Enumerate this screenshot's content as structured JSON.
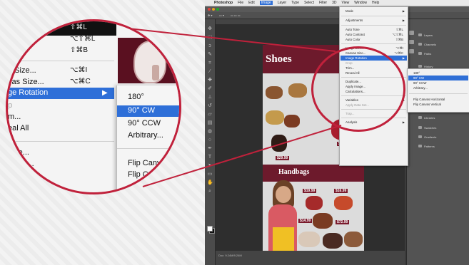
{
  "mac_menu": {
    "apple": "",
    "items": [
      "Photoshop",
      "File",
      "Edit",
      "Image",
      "Layer",
      "Type",
      "Select",
      "Filter",
      "3D",
      "View",
      "Window",
      "Help"
    ],
    "active_index": 3
  },
  "document_tab": "Untitled-1 @ 66.7%",
  "status_text": "Doc: 9.24M/9.24M",
  "image_menu": {
    "items": [
      {
        "label": "Mode",
        "shortcut": "",
        "submenu": true
      },
      {
        "label": "Adjustments",
        "shortcut": "",
        "submenu": true
      },
      {
        "label": "Auto Tone",
        "shortcut": "⇧⌘L"
      },
      {
        "label": "Auto Contrast",
        "shortcut": "⌥⇧⌘L"
      },
      {
        "label": "Auto Color",
        "shortcut": "⇧⌘B"
      },
      {
        "label": "Image Size...",
        "shortcut": "⌥⌘I"
      },
      {
        "label": "Canvas Size...",
        "shortcut": "⌥⌘C"
      },
      {
        "label": "Image Rotation",
        "shortcut": "",
        "submenu": true,
        "highlighted": true
      },
      {
        "label": "Crop",
        "shortcut": "",
        "disabled": true
      },
      {
        "label": "Trim...",
        "shortcut": ""
      },
      {
        "label": "Reveal All",
        "shortcut": ""
      },
      {
        "label": "Duplicate...",
        "shortcut": ""
      },
      {
        "label": "Apply Image...",
        "shortcut": ""
      },
      {
        "label": "Calculations...",
        "shortcut": ""
      },
      {
        "label": "Variables",
        "shortcut": "",
        "submenu": true
      },
      {
        "label": "Apply Data Set...",
        "shortcut": "",
        "disabled": true
      },
      {
        "label": "Trap...",
        "shortcut": "",
        "disabled": true
      },
      {
        "label": "Analysis",
        "shortcut": "",
        "submenu": true
      }
    ]
  },
  "rotation_submenu": {
    "items": [
      {
        "label": "180°"
      },
      {
        "label": "90° CW",
        "highlighted": true
      },
      {
        "label": "90° CCW"
      },
      {
        "label": "Arbitrary..."
      },
      {
        "label": "Flip Canvas Horizontal"
      },
      {
        "label": "Flip Canvas Vertical"
      }
    ]
  },
  "magnified": {
    "rows": [
      {
        "label": "st",
        "shortcut": "⌥⇧⌘L"
      },
      {
        "label": "or",
        "shortcut": "⇧⌘B"
      },
      {
        "label": "e Size...",
        "shortcut": "⌥⌘I"
      },
      {
        "label": "vas Size...",
        "shortcut": "⌥⌘C"
      },
      {
        "label": "ge Rotation",
        "shortcut": "▶"
      },
      {
        "label": "p",
        "shortcut": ""
      },
      {
        "label": "m...",
        "shortcut": ""
      },
      {
        "label": "eal All",
        "shortcut": ""
      },
      {
        "label": "cate...",
        "shortcut": ""
      },
      {
        "label": "mage...",
        "shortcut": ""
      },
      {
        "label": "ns...",
        "shortcut": ""
      }
    ],
    "top_shortcut": "⇧⌘L",
    "submenu": [
      "180°",
      "90° CW",
      "90° CCW",
      "Arbitrary...",
      "Flip Canvas",
      "Flip Canv"
    ]
  },
  "document": {
    "header": "Shoes",
    "header2": "Handbags",
    "prices": [
      "$29.99",
      "$19.99",
      "$16.99",
      "$14.99",
      "$72.99"
    ]
  },
  "panels": {
    "items": [
      "Layers",
      "Channels",
      "Paths",
      "History",
      "Properties",
      "Adjustments",
      "Styles",
      "Libraries",
      "Swatches",
      "Gradients",
      "Patterns"
    ]
  },
  "colors": {
    "accent_red": "#c0213b",
    "highlight_blue": "#2e6fd8",
    "brand_maroon": "#6d1a2c"
  }
}
